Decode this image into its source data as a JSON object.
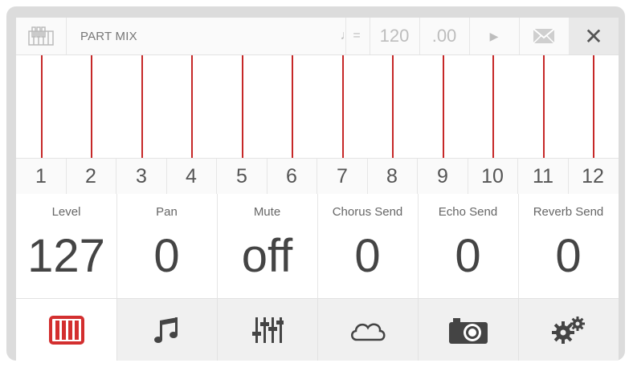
{
  "topbar": {
    "title": "PART MIX",
    "tempo_symbol": "♩=",
    "tempo": "120",
    "tempo_decimal": ".00",
    "play_symbol": "▶",
    "close_symbol": "✕",
    "icons": [
      "piano-keys-icon",
      "note-tempo-icon",
      "play-icon",
      "envelope-icon",
      "close-icon"
    ]
  },
  "parts": [
    "1",
    "2",
    "3",
    "4",
    "5",
    "6",
    "7",
    "8",
    "9",
    "10",
    "11",
    "12"
  ],
  "params": [
    {
      "label": "Level",
      "value": "127"
    },
    {
      "label": "Pan",
      "value": "0"
    },
    {
      "label": "Mute",
      "value": "off"
    },
    {
      "label": "Chorus Send",
      "value": "0"
    },
    {
      "label": "Echo Send",
      "value": "0"
    },
    {
      "label": "Reverb Send",
      "value": "0"
    }
  ],
  "tabs": [
    {
      "icon": "piano-icon",
      "active": true
    },
    {
      "icon": "music-note-icon",
      "active": false
    },
    {
      "icon": "mixer-sliders-icon",
      "active": false
    },
    {
      "icon": "cloud-icon",
      "active": false
    },
    {
      "icon": "camera-icon",
      "active": false
    },
    {
      "icon": "settings-gears-icon",
      "active": false
    }
  ],
  "colors": {
    "accent": "#c62828",
    "text": "#555555",
    "background": "#f7f7f7"
  }
}
